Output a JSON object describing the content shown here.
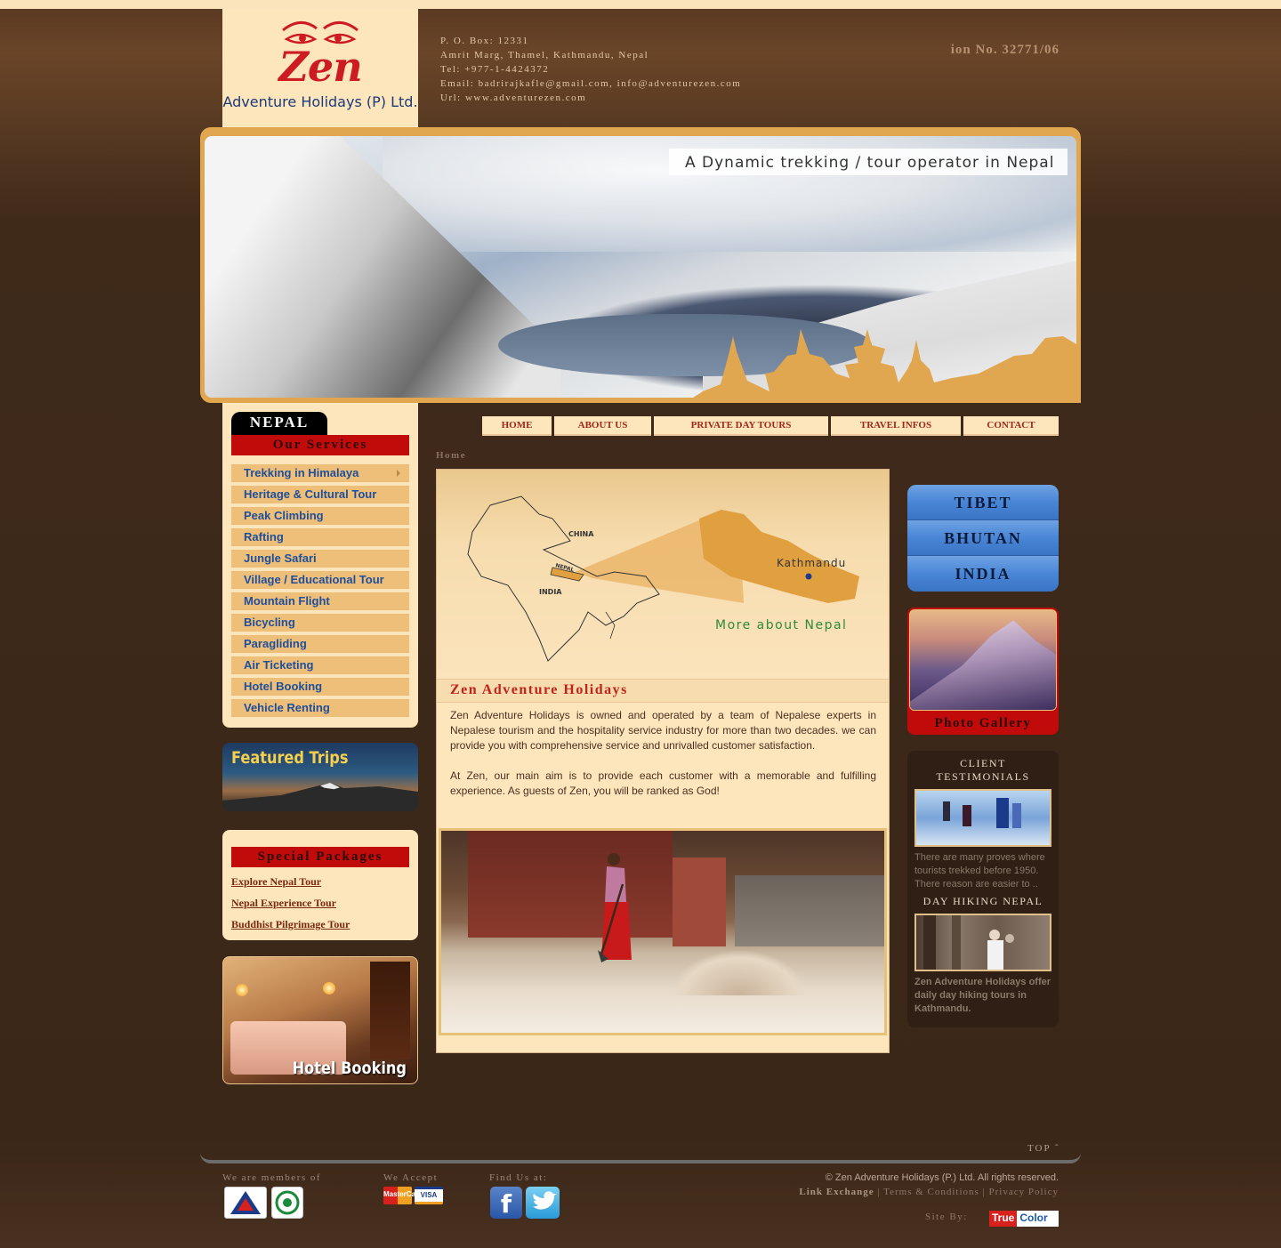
{
  "header": {
    "logo": {
      "word": "Zen",
      "subtitle": "Adventure Holidays (P) Ltd."
    },
    "address": [
      "P. O. Box: 12331",
      "Amrit Marg, Thamel, Kathmandu, Nepal",
      "Tel: +977-1-4424372",
      "Email: badrirajkafle@gmail.com, info@adventurezen.com",
      "Url: www.adventurezen.com"
    ],
    "registration": "ion No. 32771/06"
  },
  "banner": {
    "tagline": "A Dynamic trekking / tour operator in Nepal"
  },
  "left": {
    "nepal_tab": "NEPAL",
    "services_title": "Our Services",
    "services": [
      "Trekking in Himalaya",
      "Heritage & Cultural Tour",
      "Peak Climbing",
      "Rafting",
      "Jungle Safari",
      "Village / Educational Tour",
      "Mountain Flight",
      "Bicycling",
      "Paragliding",
      "Air Ticketing",
      "Hotel Booking",
      "Vehicle Renting"
    ],
    "featured_label": "Featured Trips",
    "special_title": "Special Packages",
    "special_links": [
      "Explore Nepal Tour",
      "Nepal Experience Tour",
      "Buddhist Pilgrimage Tour"
    ],
    "hotel_label": "Hotel Booking"
  },
  "nav": {
    "items": [
      "HOME",
      "ABOUT US",
      "PRIVATE DAY TOURS",
      "TRAVEL INFOS",
      "CONTACT"
    ],
    "breadcrumb": "Home"
  },
  "main": {
    "map": {
      "china": "CHINA",
      "india": "INDIA",
      "nepal": "NEPAL",
      "kathmandu": "Kathmandu",
      "more": "More about Nepal"
    },
    "title": "Zen Adventure Holidays",
    "paragraphs": [
      "Zen Adventure Holidays is owned and operated by a team of Nepalese experts in Nepalese tourism and the hospitality service industry for more than two decades. we can provide you with comprehensive service and unrivalled customer satisfaction.",
      "At Zen, our main aim is to provide each customer with a memorable and fulfilling experience. As guests of Zen, you will be ranked as God!"
    ]
  },
  "right": {
    "countries": [
      "TIBET",
      "BHUTAN",
      "INDIA"
    ],
    "gallery_label": "Photo Gallery",
    "testimonials_title": "CLIENT TESTIMONIALS",
    "testimonial_text": "There are many proves where tourists trekked before 1950. There reason are easier to ..",
    "dayhike_title": "DAY HIKING NEPAL",
    "dayhike_text": "Zen Adventure Holidays offer daily day hiking tours in Kathmandu."
  },
  "footer": {
    "top": "TOP",
    "members_label": "We are members of",
    "accept_label": "We Accept",
    "cards": [
      "MasterCard",
      "VISA"
    ],
    "find_label": "Find Us at:",
    "copyright": "© Zen Adventure Holidays (P.) Ltd. All rights reserved.",
    "links": [
      "Link Exchange",
      "Terms & Conditions",
      "Privacy Policy"
    ],
    "siteby_label": "Site By:",
    "siteby_brand": [
      "True",
      "Color"
    ]
  },
  "colors": {
    "accent_red": "#c10a0a",
    "cream": "#fde5bc",
    "link_blue": "#1f4e9c",
    "country_blue": "#4a86d6"
  }
}
